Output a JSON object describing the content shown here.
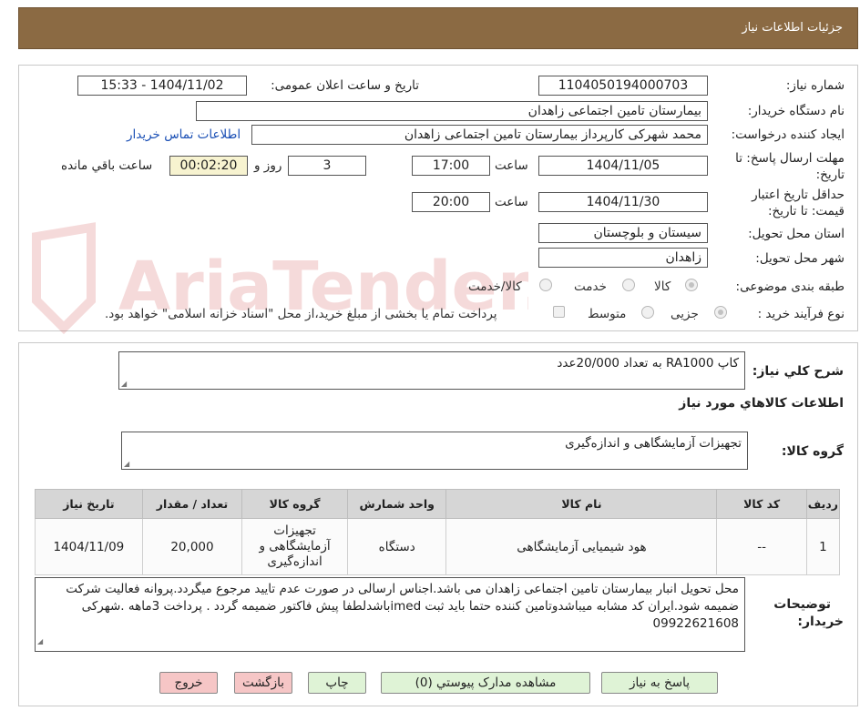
{
  "header": {
    "title": "جزئیات اطلاعات نیاز"
  },
  "watermark": {
    "text": "AriaTender.neT"
  },
  "form": {
    "need_number": {
      "label": "شماره نیاز:",
      "value": "1104050194000703"
    },
    "announce": {
      "label": "تاریخ و ساعت اعلان عمومی:",
      "value": "1404/11/02 - 15:33"
    },
    "buyer_org": {
      "label": "نام دستگاه خریدار:",
      "value": "بیمارستان تامین اجتماعی زاهدان"
    },
    "requester": {
      "label": "ایجاد کننده درخواست:",
      "value": "محمد شهرکی کارپرداز بیمارستان تامین اجتماعی زاهدان",
      "contact_link": "اطلاعات تماس خریدار"
    },
    "reply_deadline": {
      "label_line1": "مهلت ارسال پاسخ: تا",
      "label_line2": "تاریخ:",
      "date": "1404/11/05",
      "time_label": "ساعت",
      "time": "17:00",
      "days": "3",
      "days_label": "روز و",
      "remaining": "00:02:20",
      "remaining_label": "ساعت باقي مانده"
    },
    "price_validity": {
      "label_line1": "حداقل تاریخ اعتبار",
      "label_line2": "قیمت: تا تاریخ:",
      "date": "1404/11/30",
      "time_label": "ساعت",
      "time": "20:00"
    },
    "province": {
      "label": "استان محل تحویل:",
      "value": "سیستان و بلوچستان"
    },
    "city": {
      "label": "شهر محل تحویل:",
      "value": "زاهدان"
    },
    "category": {
      "label": "طبقه بندی موضوعی:",
      "options": [
        "کالا",
        "خدمت",
        "کالا/خدمت"
      ],
      "selected": "کالا"
    },
    "purchase_type": {
      "label": "نوع فرآیند خرید :",
      "options": [
        "جزیی",
        "متوسط"
      ],
      "selected": "جزیی",
      "payment_note": "پرداخت تمام یا بخشی از مبلغ خرید،از محل \"اسناد خزانه اسلامی\" خواهد بود."
    }
  },
  "summary": {
    "label": "شرح کلي نیاز:",
    "value": "کاپ RA1000 به تعداد 20/000عدد",
    "goods_section_title": "اطلاعات کالاهاي مورد نیاز",
    "goods_group_label": "گروه کالا:",
    "goods_group_value": "تجهیزات آزمایشگاهی و اندازه‌گیری"
  },
  "table": {
    "headers": [
      "ردیف",
      "کد کالا",
      "نام کالا",
      "واحد شمارش",
      "گروه کالا",
      "تعداد / مقدار",
      "تاریخ نیاز"
    ],
    "rows": [
      [
        "1",
        "--",
        "هود شیمیایی آزمایشگاهی",
        "دستگاه",
        "تجهیزات آزمایشگاهی و اندازه‌گیری",
        "20,000",
        "1404/11/09"
      ]
    ]
  },
  "notes": {
    "label_line1": "توضیحات",
    "label_line2": "خریدار:",
    "value": "محل تحویل انبار بیمارستان تامین اجتماعی زاهدان می باشد.اجناس ارسالی در صورت عدم تایید مرجوع میگردد.پروانه فعالیت شرکت ضمیمه شود.ایران کد مشابه میباشدوتامین کننده حتما باید ثبت imedباشدلطفا پیش فاکتور ضمیمه گردد . پرداخت 3ماهه  .شهرکی 09922621608"
  },
  "buttons": {
    "reply": "پاسخ به نیاز",
    "attachments": "مشاهده مدارک پیوستي (0)",
    "print": "چاپ",
    "back": "بازگشت",
    "exit": "خروج"
  },
  "colors": {
    "header_bg": "#8b6a43",
    "link": "#1a4fb5",
    "time_bg": "#f7f3d0",
    "green_btn": "#dff3d6",
    "red_btn": "#f6c6c6"
  }
}
